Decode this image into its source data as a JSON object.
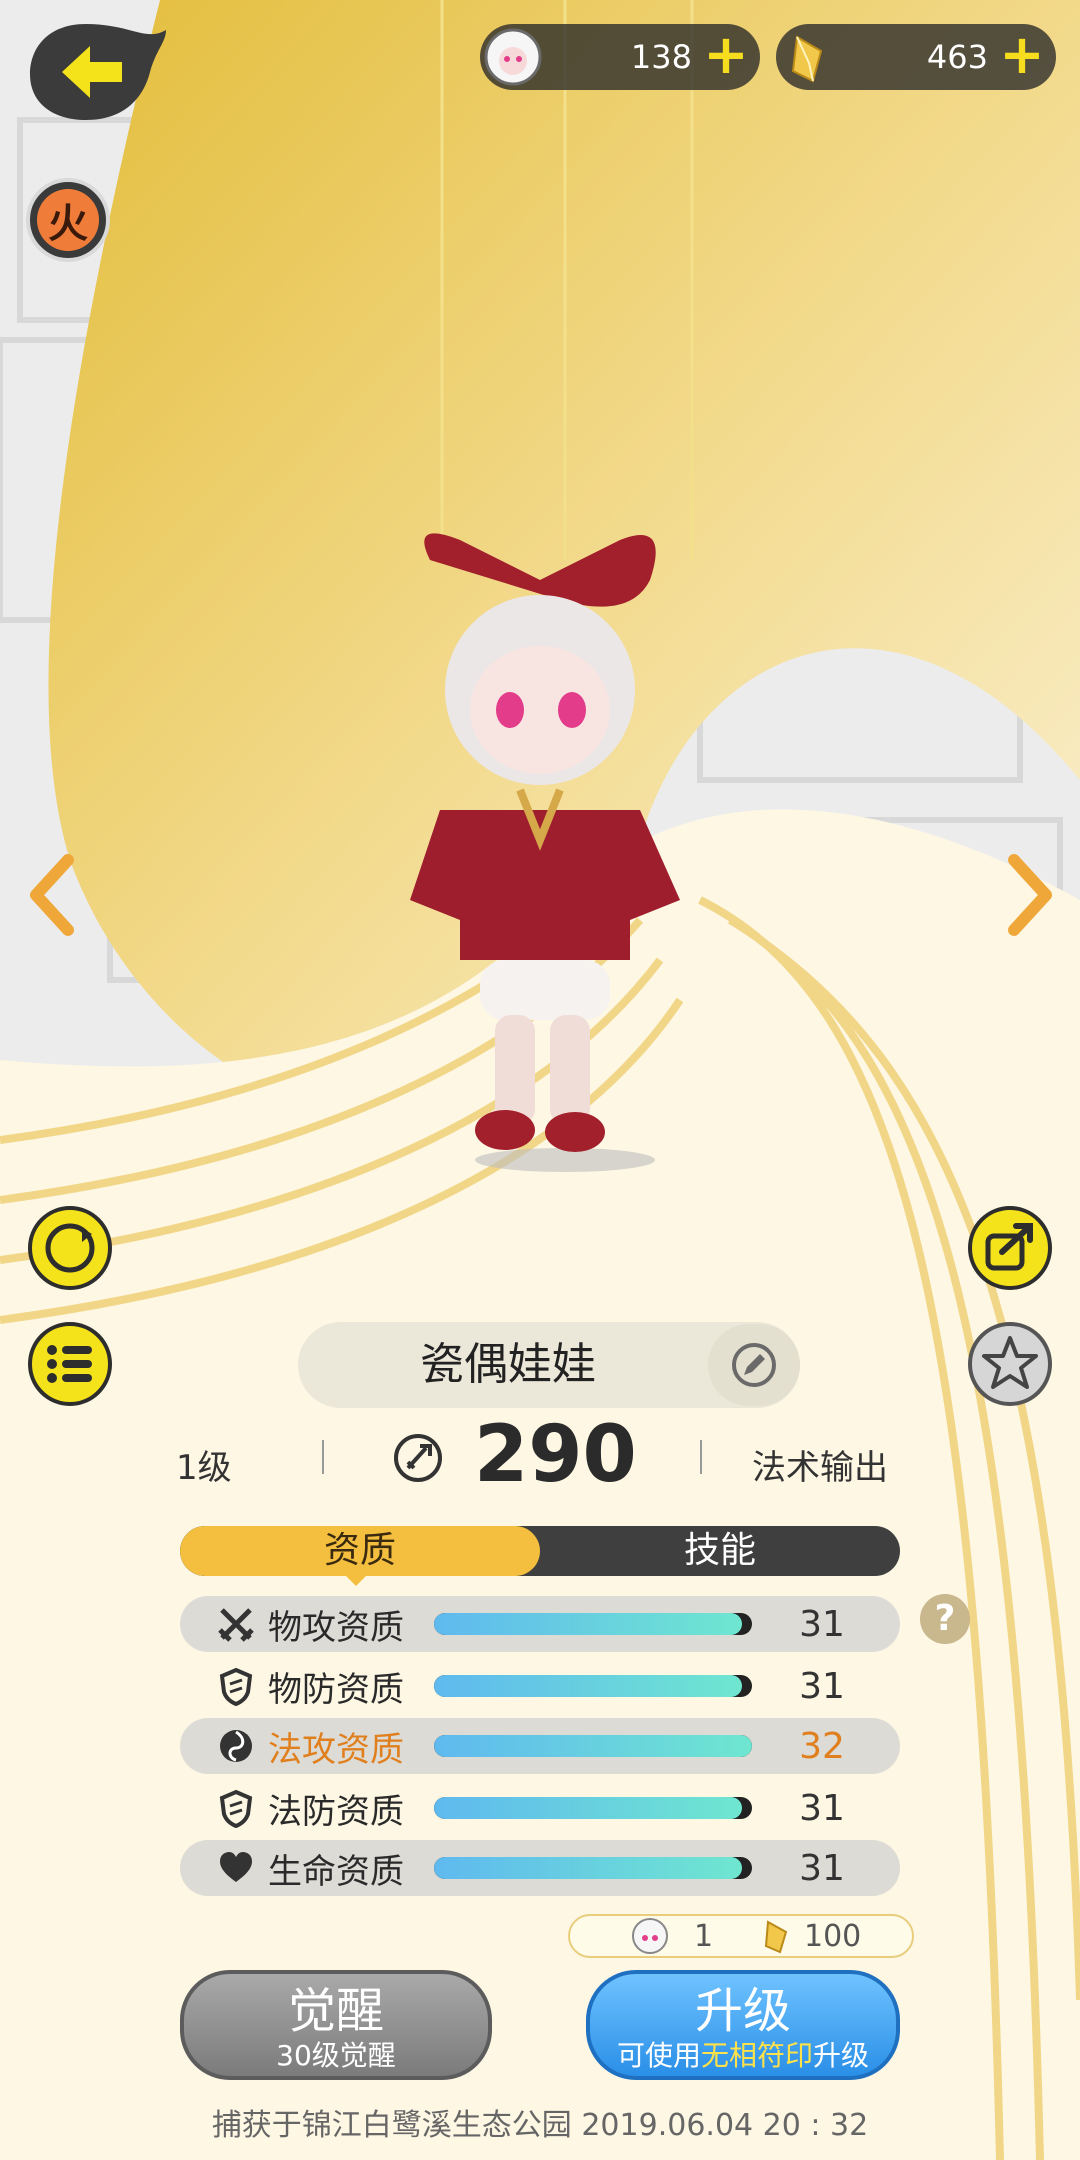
{
  "header": {
    "back_icon": "arrow-left-icon",
    "element_badge": "火",
    "currencies": [
      {
        "icon": "doll-face-icon",
        "value": "138",
        "plus": "+"
      },
      {
        "icon": "gold-crystal-icon",
        "value": "463",
        "plus": "+"
      }
    ]
  },
  "spirit": {
    "name": "瓷偶娃娃",
    "level": "1级",
    "power": "290",
    "role": "法术输出"
  },
  "tabs": [
    {
      "label": "资质",
      "active": true
    },
    {
      "label": "技能",
      "active": false
    }
  ],
  "attributes": [
    {
      "icon": "crossed-swords-icon",
      "label": "物攻资质",
      "value": "31",
      "fill": 0.97
    },
    {
      "icon": "shield-icon",
      "label": "物防资质",
      "value": "31",
      "fill": 0.97
    },
    {
      "icon": "magic-swirl-icon",
      "label": "法攻资质",
      "value": "32",
      "fill": 1.0
    },
    {
      "icon": "shield-icon",
      "label": "法防资质",
      "value": "31",
      "fill": 0.97
    },
    {
      "icon": "heart-icon",
      "label": "生命资质",
      "value": "31",
      "fill": 0.97
    }
  ],
  "help_label": "?",
  "cost": {
    "doll_amount": "1",
    "crystal_amount": "100"
  },
  "actions": {
    "awaken": {
      "label": "觉醒",
      "sub": "30级觉醒"
    },
    "upgrade": {
      "label": "升级",
      "sub_prefix": "可使用",
      "sub_highlight": "无相符印",
      "sub_suffix": "升级"
    }
  },
  "footer": "捕获于锦江白鹭溪生态公园  2019.06.04    20 : 32",
  "colors": {
    "gold": "#f4be3e",
    "blue": "#2a8fe7",
    "highlight": "#e07f1d",
    "yellow": "#f4e21b"
  }
}
